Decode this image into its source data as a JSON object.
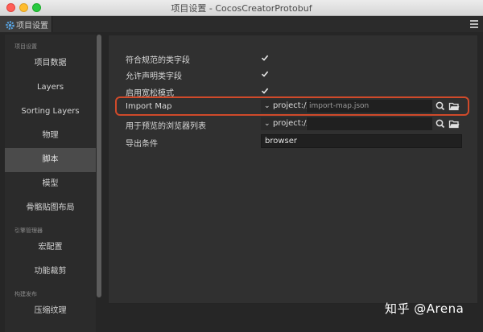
{
  "window": {
    "title": "项目设置 - CocosCreatorProtobuf"
  },
  "tab": {
    "label": "项目设置",
    "icon": "gear-icon"
  },
  "menu": {
    "icon": "hamburger-menu-icon"
  },
  "sidebar": {
    "sections": [
      {
        "title": "项目设置",
        "items": [
          {
            "label": "项目数据",
            "active": false
          },
          {
            "label": "Layers",
            "active": false
          },
          {
            "label": "Sorting Layers",
            "active": false
          },
          {
            "label": "物理",
            "active": false
          },
          {
            "label": "脚本",
            "active": true
          },
          {
            "label": "模型",
            "active": false
          },
          {
            "label": "骨骼贴图布局",
            "active": false
          }
        ]
      },
      {
        "title": "引擎管理器",
        "items": [
          {
            "label": "宏配置",
            "active": false
          },
          {
            "label": "功能裁剪",
            "active": false
          }
        ]
      },
      {
        "title": "构建发布",
        "items": [
          {
            "label": "压缩纹理",
            "active": false
          }
        ]
      }
    ]
  },
  "settings": {
    "rows": {
      "conform_class_fields": {
        "label": "符合规范的类字段",
        "checked": true
      },
      "allow_declared_class_fields": {
        "label": "允许声明类字段",
        "checked": true
      },
      "loose_mode": {
        "label": "启用宽松模式",
        "checked": true
      },
      "import_map": {
        "label": "Import Map",
        "protocol": "project://",
        "value": "import-map.json"
      },
      "preview_browserslist": {
        "label": "用于预览的浏览器列表",
        "protocol": "project://",
        "value": ""
      },
      "export_conditions": {
        "label": "导出条件",
        "value": "browser"
      }
    }
  },
  "colors": {
    "highlight": "#d04a2a",
    "active_item": "#4b4b4b"
  },
  "watermark": {
    "text": "知乎 @Arena"
  }
}
